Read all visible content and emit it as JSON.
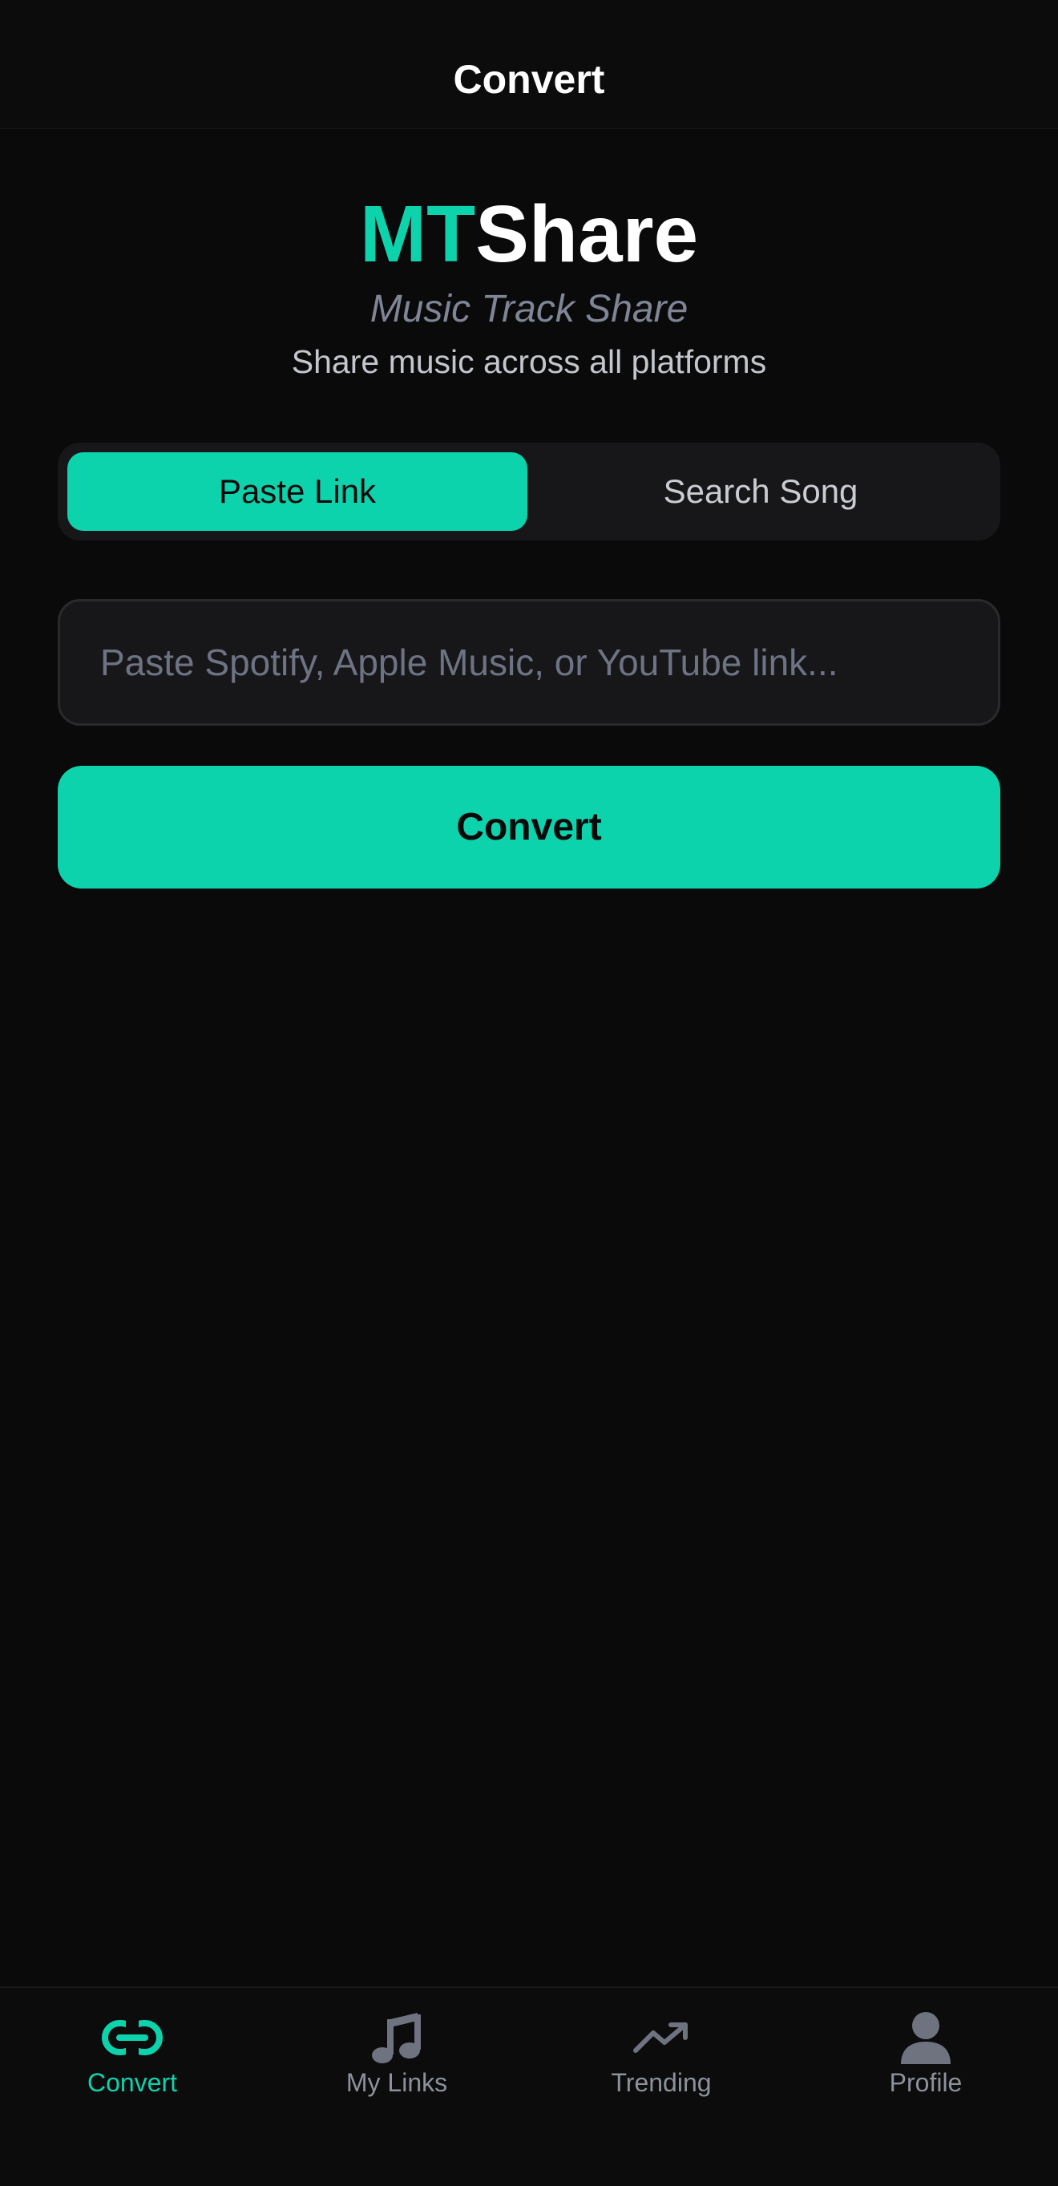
{
  "nav": {
    "title": "Convert"
  },
  "brand": {
    "logo_accent": "MT",
    "logo_rest": "Share",
    "subtitle": "Music Track Share",
    "tagline": "Share music across all platforms"
  },
  "mode_toggle": {
    "options": [
      {
        "label": "Paste Link",
        "selected": true
      },
      {
        "label": "Search Song",
        "selected": false
      }
    ]
  },
  "link_input": {
    "value": "",
    "placeholder": "Paste Spotify, Apple Music, or YouTube link..."
  },
  "convert_button": {
    "label": "Convert"
  },
  "tab_bar": {
    "items": [
      {
        "label": "Convert",
        "icon": "link-icon",
        "active": true
      },
      {
        "label": "My Links",
        "icon": "music-note-icon",
        "active": false
      },
      {
        "label": "Trending",
        "icon": "trending-up-icon",
        "active": false
      },
      {
        "label": "Profile",
        "icon": "person-icon",
        "active": false
      }
    ]
  },
  "colors": {
    "accent": "#0dd3ad",
    "background": "#0a0a0a",
    "surface": "#171719",
    "inactive_icon": "#6f7380"
  }
}
